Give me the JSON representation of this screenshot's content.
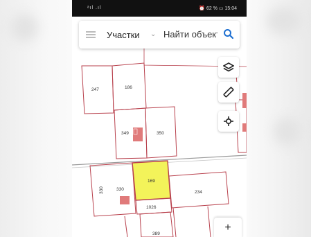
{
  "status_bar": {
    "signal": "ᵃıl .ıl",
    "battery_percent": "62 %",
    "time": "15:04"
  },
  "search_bar": {
    "layer_label": "Участки",
    "placeholder": "Найти объект"
  },
  "map": {
    "plots": [
      {
        "id": "247",
        "label": "247"
      },
      {
        "id": "186",
        "label": "186"
      },
      {
        "id": "349",
        "label": "349"
      },
      {
        "id": "350",
        "label": "350"
      },
      {
        "id": "330",
        "label": "330"
      },
      {
        "id": "330-side",
        "label": "330"
      },
      {
        "id": "169",
        "label": "169",
        "selected": true
      },
      {
        "id": "234",
        "label": "234"
      },
      {
        "id": "1026",
        "label": "1026"
      },
      {
        "id": "389",
        "label": "389"
      }
    ],
    "colors": {
      "boundary": "#b8404c",
      "building": "#e07a7a",
      "selected_fill": "#f3f35a",
      "road": "#9a9a9a"
    }
  },
  "tools": [
    {
      "name": "layers-icon"
    },
    {
      "name": "ruler-icon"
    },
    {
      "name": "locate-icon"
    }
  ],
  "zoom_in_label": "+"
}
